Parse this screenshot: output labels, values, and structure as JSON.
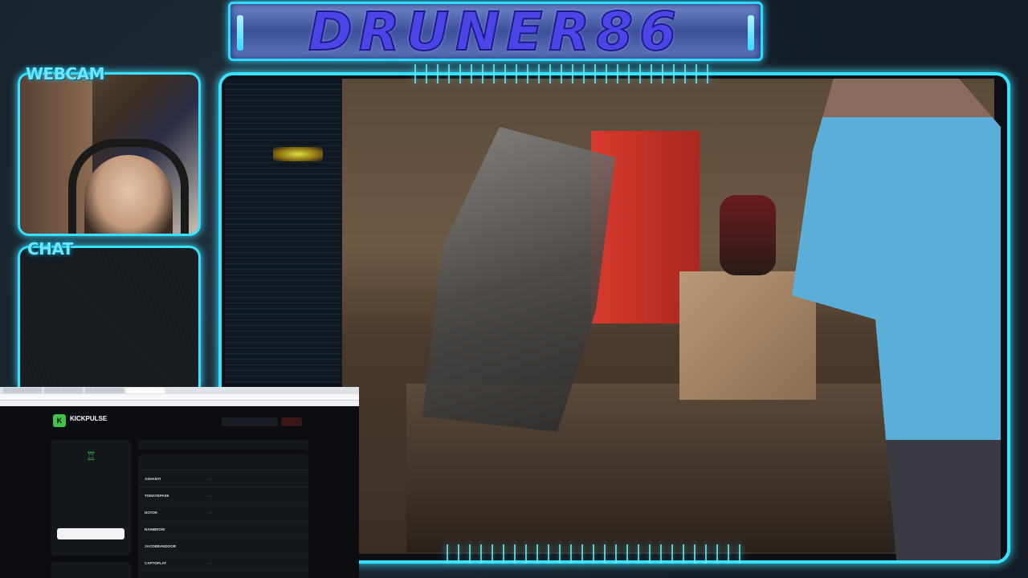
{
  "banner": {
    "title": "DRUNER86"
  },
  "labels": {
    "webcam": "WEBCAM",
    "chat": "CHAT"
  },
  "kickpulse": {
    "brand": "KICKPULSE",
    "logo_letter": "K",
    "subtitle": "",
    "search_value": "",
    "action_label": "",
    "filter_placeholder": "",
    "columns": [
      "",
      "",
      "",
      ""
    ],
    "rows": [
      {
        "name": "ASHANTI"
      },
      {
        "name": "TOMATEPASE"
      },
      {
        "name": "DOTOK"
      },
      {
        "name": "RAINBROW"
      },
      {
        "name": "JACOBRANDOOR"
      },
      {
        "name": "CAPTOPLAT"
      }
    ]
  },
  "colors": {
    "accent": "#39e1ff",
    "title_text": "#4b45e8",
    "kickpulse_green": "#42c44a"
  }
}
